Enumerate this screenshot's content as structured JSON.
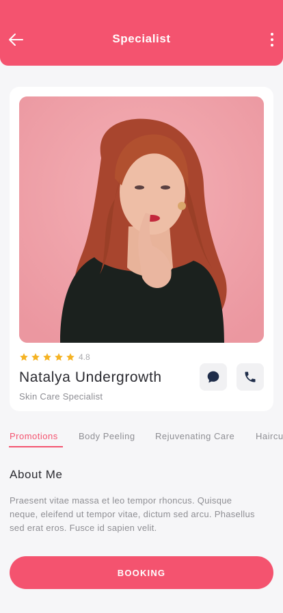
{
  "header": {
    "title": "Specialist"
  },
  "colors": {
    "accent": "#f4536f",
    "star": "#f5b324",
    "background": "#f6f6f8"
  },
  "specialist": {
    "rating": "4.8",
    "rating_value": 4.8,
    "stars_filled": 5,
    "name": "Natalya Undergrowth",
    "role": "Skin Care Specialist"
  },
  "tabs": [
    {
      "label": "Promotions",
      "active": true
    },
    {
      "label": "Body Peeling",
      "active": false
    },
    {
      "label": "Rejuvenating Care",
      "active": false
    },
    {
      "label": "Haircu",
      "active": false
    }
  ],
  "about": {
    "title": "About Me",
    "text": "Praesent vitae massa et leo tempor rhoncus. Quisque neque, eleifend ut tempor vitae, dictum sed arcu. Phasellus sed erat eros. Fusce id sapien velit."
  },
  "booking": {
    "label": "BOOKING"
  },
  "icons": [
    "arrow-left-icon",
    "more-vertical-icon",
    "star-icon",
    "chat-icon",
    "phone-icon"
  ]
}
